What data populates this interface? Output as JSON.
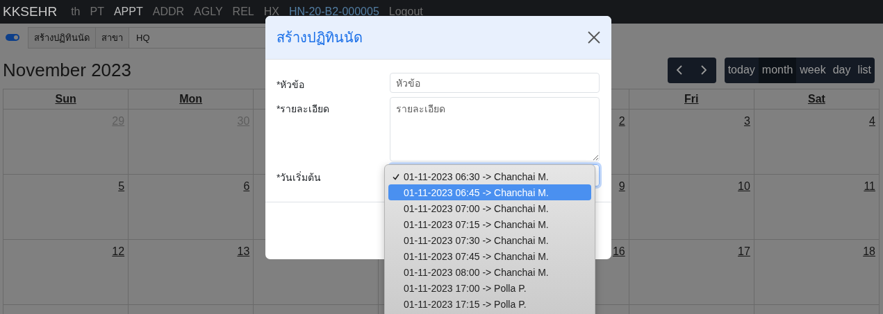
{
  "navbar": {
    "brand": "KKSEHR",
    "links": [
      {
        "label": "th",
        "selected": false
      },
      {
        "label": "PT",
        "selected": false
      },
      {
        "label": "APPT",
        "selected": true
      },
      {
        "label": "ADDR",
        "selected": false
      },
      {
        "label": "AGLY",
        "selected": false
      },
      {
        "label": "REL",
        "selected": false
      },
      {
        "label": "HX",
        "selected": false
      }
    ],
    "patient_id": "HN-20-B2-000005",
    "logout": "Logout"
  },
  "toolbar": {
    "toggle_on": true,
    "crumbs": [
      "สร้างปฏิทินนัด",
      "สาขา"
    ],
    "branch_value": "HQ"
  },
  "calendar": {
    "title": "November 2023",
    "views": [
      {
        "label": "today",
        "selected": false
      },
      {
        "label": "month",
        "selected": true
      },
      {
        "label": "week",
        "selected": false
      },
      {
        "label": "day",
        "selected": false
      },
      {
        "label": "list",
        "selected": false
      }
    ],
    "day_headers": {
      "sun": "Sun",
      "mon": "Mon",
      "fri": "Fri",
      "sat": "Sat"
    },
    "weeks": [
      {
        "sun": {
          "day": "29",
          "other_month": true
        },
        "mon": {
          "day": "30",
          "other_month": true
        },
        "thu": {
          "day": "2",
          "other_month": false
        },
        "fri": {
          "day": "3",
          "other_month": false
        },
        "sat": {
          "day": "4",
          "other_month": false
        }
      },
      {
        "sun": {
          "day": "5",
          "other_month": false
        },
        "mon": {
          "day": "6",
          "other_month": false
        },
        "thu": {
          "day": "9",
          "other_month": false
        },
        "fri": {
          "day": "10",
          "other_month": false
        },
        "sat": {
          "day": "11",
          "other_month": false
        }
      },
      {
        "sun": {
          "day": "12",
          "other_month": false
        },
        "mon": {
          "day": "13",
          "other_month": false
        },
        "thu": {
          "day": "16",
          "other_month": false
        },
        "fri": {
          "day": "17",
          "other_month": false
        },
        "sat": {
          "day": "18",
          "other_month": false
        }
      }
    ]
  },
  "modal": {
    "title": "สร้างปฏิทินนัด",
    "fields": [
      {
        "kind": "text",
        "label": "*หัวข้อ",
        "placeholder": "หัวข้อ"
      },
      {
        "kind": "textarea",
        "label": "*รายละเอียด",
        "placeholder": "รายละเอียด"
      },
      {
        "kind": "select",
        "label": "*วันเริ่มต้น"
      }
    ]
  },
  "dropdown": {
    "options": [
      {
        "label": "01-11-2023 06:30 -> Chanchai M.",
        "selected": true,
        "highlighted": false
      },
      {
        "label": "01-11-2023 06:45 -> Chanchai M.",
        "selected": false,
        "highlighted": true
      },
      {
        "label": "01-11-2023 07:00 -> Chanchai M.",
        "selected": false,
        "highlighted": false
      },
      {
        "label": "01-11-2023 07:15 -> Chanchai M.",
        "selected": false,
        "highlighted": false
      },
      {
        "label": "01-11-2023 07:30 -> Chanchai M.",
        "selected": false,
        "highlighted": false
      },
      {
        "label": "01-11-2023 07:45 -> Chanchai M.",
        "selected": false,
        "highlighted": false
      },
      {
        "label": "01-11-2023 08:00 -> Chanchai M.",
        "selected": false,
        "highlighted": false
      },
      {
        "label": "01-11-2023 17:00 -> Polla P.",
        "selected": false,
        "highlighted": false
      },
      {
        "label": "01-11-2023 17:15 -> Polla P.",
        "selected": false,
        "highlighted": false
      }
    ]
  }
}
